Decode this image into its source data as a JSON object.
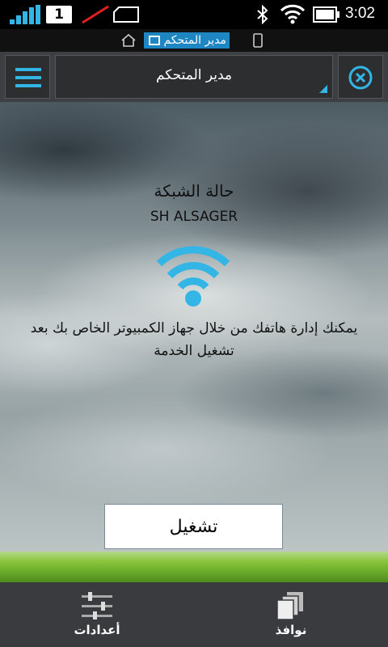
{
  "status_bar": {
    "sim_slot": "1",
    "time": "3:02"
  },
  "notification": {
    "app_title": "مدير المتحكم"
  },
  "action_bar": {
    "spinner_label": "مدير المتحكم"
  },
  "main": {
    "network_title": "حالة الشبكة",
    "network_name": "SH ALSAGER",
    "description": "يمكنك إدارة هاتفك من خلال جهاز الكمبيوتر الخاص بك بعد تشغيل الخدمة",
    "start_button": "تشغيل"
  },
  "bottom_bar": {
    "settings_label": "أعدادات",
    "windows_label": "نوافذ"
  },
  "colors": {
    "accent": "#33b5e5",
    "action_bar": "#3d3f42",
    "bottom_bar": "#3a3b3e",
    "grass": "#8cc63f"
  }
}
